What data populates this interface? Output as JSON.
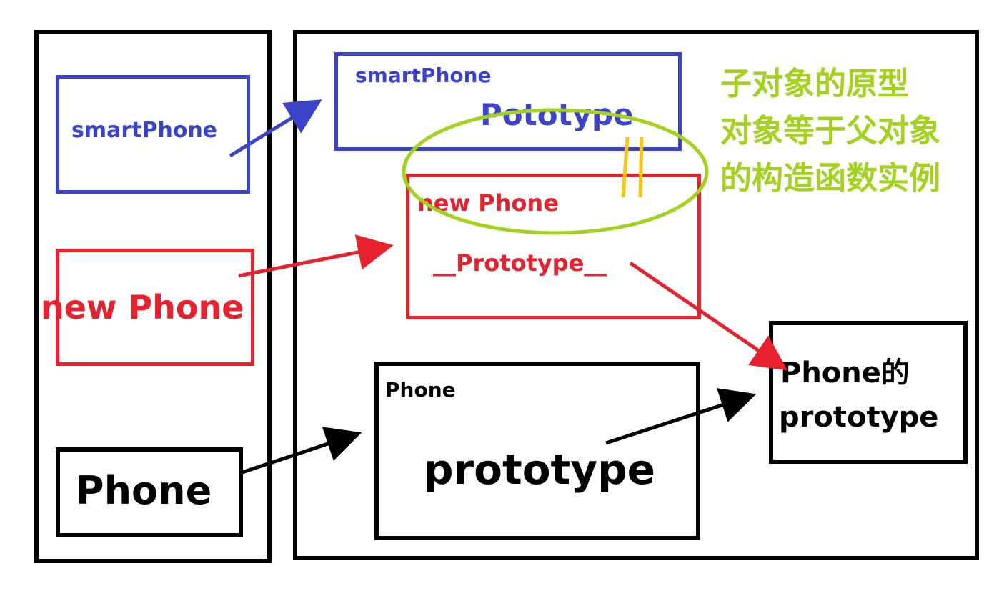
{
  "colors": {
    "blue": "#3b44c8",
    "red": "#e8212e",
    "black": "#000000",
    "green": "#a3d21e",
    "yellow": "#f5c518"
  },
  "left_column": {
    "smartphone_label": "smartPhone",
    "new_phone_label": "new Phone",
    "phone_label": "Phone"
  },
  "memory": {
    "smartphone_box": {
      "title": "smartPhone",
      "property": "Pototype"
    },
    "new_phone_box": {
      "title": "new Phone",
      "property": "__Prototype__"
    },
    "phone_box": {
      "title": "Phone",
      "property": "prototype"
    },
    "phone_prototype_box": {
      "line1": "Phone的",
      "line2": "prototype"
    },
    "equals_mark": "||",
    "annotation": {
      "line1": "子对象的原型",
      "line2": "对象等于父对象",
      "line3": "的构造函数实例"
    }
  }
}
